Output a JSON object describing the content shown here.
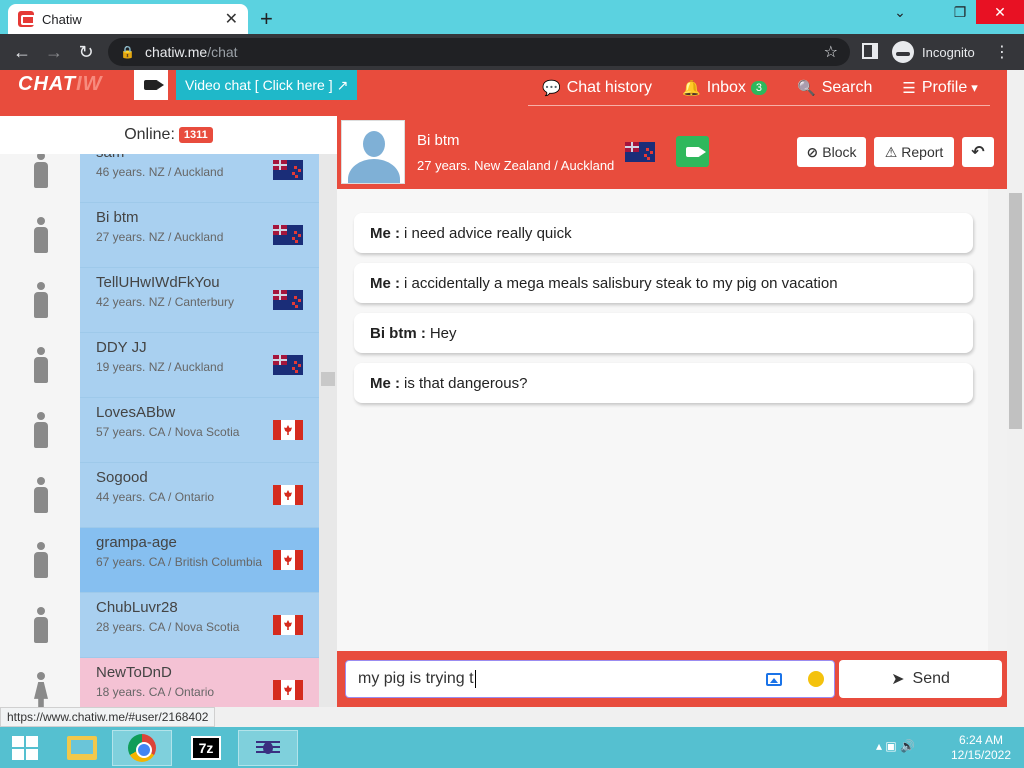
{
  "browser": {
    "tab_title": "Chatiw",
    "close_glyph": "✕",
    "newtab_glyph": "+",
    "win_min_glyph": "⌄",
    "win_restore_glyph": "❐",
    "win_close_glyph": "✕",
    "back_glyph": "←",
    "forward_glyph": "→",
    "reload_glyph": "↻",
    "lock_glyph": "🔒",
    "url_host": "chatiw.me",
    "url_path": "/chat",
    "star_glyph": "☆",
    "incognito_label": "Incognito",
    "menu_glyph": "⋮",
    "status_url": "https://www.chatiw.me/#user/2168402"
  },
  "site": {
    "logo_main": "CHAT",
    "logo_tail": "IW",
    "video_chat_label": "Video chat  [ Click here ]",
    "video_chat_icon": "↗",
    "nav": {
      "chat_history": "Chat history",
      "inbox": "Inbox",
      "inbox_count": "3",
      "search": "Search",
      "profile": "Profile",
      "chat_history_icon": "💬",
      "inbox_icon": "🔔",
      "search_icon": "🔍",
      "profile_icon": "☰",
      "profile_caret": "▾"
    }
  },
  "online": {
    "label": "Online:",
    "count": "1311"
  },
  "users": [
    {
      "name": "sam",
      "meta": "46 years. NZ / Auckland",
      "flag": "nz",
      "gender": "male",
      "state": "normal"
    },
    {
      "name": "Bi btm",
      "meta": "27 years. NZ / Auckland",
      "flag": "nz",
      "gender": "male",
      "state": "normal"
    },
    {
      "name": "TellUHwIWdFkYou",
      "meta": "42 years. NZ / Canterbury",
      "flag": "nz",
      "gender": "male",
      "state": "normal"
    },
    {
      "name": "DDY JJ",
      "meta": "19 years. NZ / Auckland",
      "flag": "nz",
      "gender": "male",
      "state": "normal"
    },
    {
      "name": "LovesABbw",
      "meta": "57 years. CA / Nova Scotia",
      "flag": "ca",
      "gender": "male",
      "state": "normal"
    },
    {
      "name": "Sogood",
      "meta": "44 years. CA / Ontario",
      "flag": "ca",
      "gender": "male",
      "state": "normal"
    },
    {
      "name": "grampa-age",
      "meta": "67 years. CA / British Columbia",
      "flag": "ca",
      "gender": "male",
      "state": "selected"
    },
    {
      "name": "ChubLuvr28",
      "meta": "28 years. CA / Nova Scotia",
      "flag": "ca",
      "gender": "male",
      "state": "normal"
    },
    {
      "name": "NewToDnD",
      "meta": "18 years. CA / Ontario",
      "flag": "ca",
      "gender": "female",
      "state": "normal"
    }
  ],
  "chat": {
    "peer_name": "Bi btm",
    "peer_meta": "27 years. New Zealand / Auckland",
    "block_label": "Block",
    "block_icon": "⊘",
    "report_label": "Report",
    "report_icon": "⚠",
    "back_icon": "↶",
    "messages": [
      {
        "who": "Me :",
        "text": "i need advice really quick"
      },
      {
        "who": "Me :",
        "text": "i accidentally a mega meals salisbury steak to my pig on vacation"
      },
      {
        "who": "Bi btm :",
        "text": "Hey"
      },
      {
        "who": "Me :",
        "text": "is that dangerous?"
      }
    ],
    "input_value": "my pig is trying t",
    "send_label": "Send",
    "send_icon": "➤"
  },
  "taskbar": {
    "sevenzip_label": "7z",
    "tray_icons": "▴  ▣  🔊",
    "time": "6:24 AM",
    "date": "12/15/2022"
  },
  "colors": {
    "brand_red": "#e84c3d",
    "accent_teal": "#1fb8c9",
    "inbox_green": "#2eb85c"
  }
}
